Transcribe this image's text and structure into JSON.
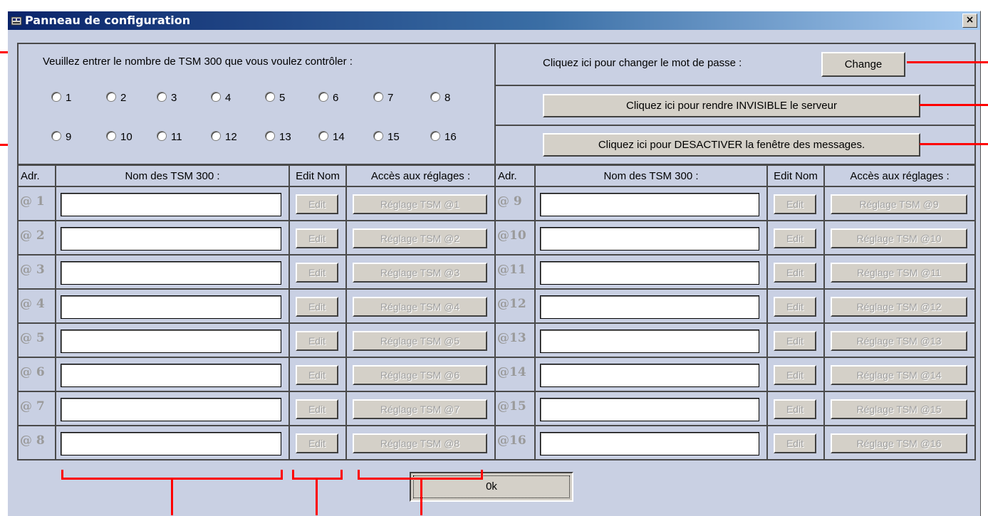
{
  "window": {
    "title": "Panneau de configuration",
    "close_glyph": "×"
  },
  "count_panel": {
    "prompt": "Veuillez entrer le nombre de TSM 300 que vous voulez contrôler :",
    "options": [
      "1",
      "2",
      "3",
      "4",
      "5",
      "6",
      "7",
      "8",
      "9",
      "10",
      "11",
      "12",
      "13",
      "14",
      "15",
      "16"
    ]
  },
  "password": {
    "label": "Cliquez ici pour changer le mot de passe :",
    "button": "Change"
  },
  "invisible_button": "Cliquez ici pour rendre INVISIBLE le serveur",
  "messages_button": "Cliquez ici pour DESACTIVER la fenêtre des messages.",
  "table": {
    "headers": {
      "addr": "Adr.",
      "name": "Nom des TSM 300 :",
      "edit": "Edit Nom",
      "access": "Accès aux réglages :"
    },
    "left_rows": [
      {
        "addr": "@ 1",
        "edit": "Edit",
        "access": "Réglage TSM  @1"
      },
      {
        "addr": "@ 2",
        "edit": "Edit",
        "access": "Réglage TSM  @2"
      },
      {
        "addr": "@ 3",
        "edit": "Edit",
        "access": "Réglage TSM  @3"
      },
      {
        "addr": "@ 4",
        "edit": "Edit",
        "access": "Réglage TSM  @4"
      },
      {
        "addr": "@ 5",
        "edit": "Edit",
        "access": "Réglage TSM  @5"
      },
      {
        "addr": "@ 6",
        "edit": "Edit",
        "access": "Réglage TSM  @6"
      },
      {
        "addr": "@ 7",
        "edit": "Edit",
        "access": "Réglage TSM  @7"
      },
      {
        "addr": "@ 8",
        "edit": "Edit",
        "access": "Réglage TSM  @8"
      }
    ],
    "right_rows": [
      {
        "addr": "@ 9",
        "edit": "Edit",
        "access": "Réglage TSM  @9"
      },
      {
        "addr": "@10",
        "edit": "Edit",
        "access": "Réglage TSM  @10"
      },
      {
        "addr": "@11",
        "edit": "Edit",
        "access": "Réglage TSM  @11"
      },
      {
        "addr": "@12",
        "edit": "Edit",
        "access": "Réglage TSM  @12"
      },
      {
        "addr": "@13",
        "edit": "Edit",
        "access": "Réglage TSM  @13"
      },
      {
        "addr": "@14",
        "edit": "Edit",
        "access": "Réglage TSM  @14"
      },
      {
        "addr": "@15",
        "edit": "Edit",
        "access": "Réglage TSM  @15"
      },
      {
        "addr": "@16",
        "edit": "Edit",
        "access": "Réglage TSM  @16"
      }
    ]
  },
  "ok_button": "0k",
  "colors": {
    "window_bg": "#c9d0e3",
    "titlebar_start": "#0a246a",
    "titlebar_end": "#a6caf0",
    "annotation": "#ff0000",
    "disabled_text": "#a0a0a0"
  }
}
